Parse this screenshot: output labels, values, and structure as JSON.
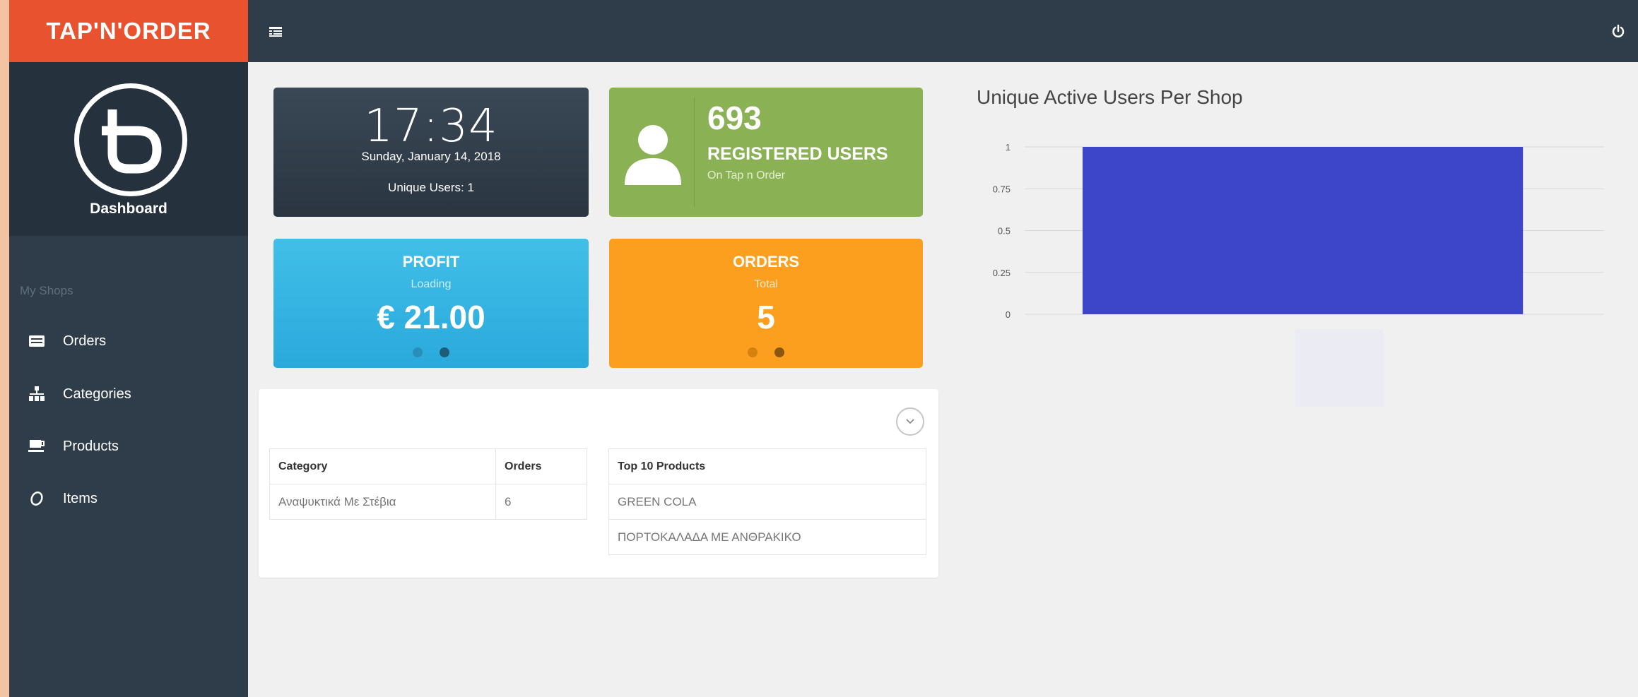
{
  "brand": {
    "name": "TAP'N'ORDER"
  },
  "sidebar": {
    "profile_label": "Dashboard",
    "section_label": "My Shops",
    "items": [
      {
        "label": "Orders",
        "icon": "list-icon"
      },
      {
        "label": "Categories",
        "icon": "sitemap-icon"
      },
      {
        "label": "Products",
        "icon": "coffee-icon"
      },
      {
        "label": "Items",
        "icon": "circle-outline-icon"
      }
    ]
  },
  "topbar": {
    "menu_icon": "menu-toggle-icon",
    "power_icon": "power-icon"
  },
  "clock": {
    "time": "17:34",
    "date": "Sunday, January 14, 2018",
    "unique_users": "Unique Users: 1"
  },
  "registered": {
    "count": "693",
    "label": "REGISTERED USERS",
    "sub": "On Tap n Order"
  },
  "profit": {
    "title": "PROFIT",
    "sub": "Loading",
    "value": "€ 21.00"
  },
  "orders": {
    "title": "ORDERS",
    "sub": "Total",
    "value": "5"
  },
  "category_table": {
    "headers": [
      "Category",
      "Orders"
    ],
    "rows": [
      [
        "Αναψυκτικά Με Στέβια",
        "6"
      ]
    ]
  },
  "products_table": {
    "header": "Top 10 Products",
    "rows": [
      "GREEN COLA",
      "ΠΟΡΤΟΚΑΛΑΔΑ ΜΕ ΑΝΘΡΑΚΙΚΟ"
    ]
  },
  "chart_data": {
    "type": "bar",
    "title": "Unique Active Users Per Shop",
    "categories": [
      ""
    ],
    "values": [
      1
    ],
    "yticks": [
      "0",
      "0.25",
      "0.5",
      "0.75",
      "1"
    ],
    "ylim": [
      0,
      1
    ],
    "grid": true,
    "bar_color": "#3d46c8"
  },
  "colors": {
    "brand": "#e8522f",
    "sidebar": "#2f3d4a",
    "users_tile": "#8bb155",
    "profit_tile": "#35b4e2",
    "orders_tile": "#fd9f1e"
  }
}
